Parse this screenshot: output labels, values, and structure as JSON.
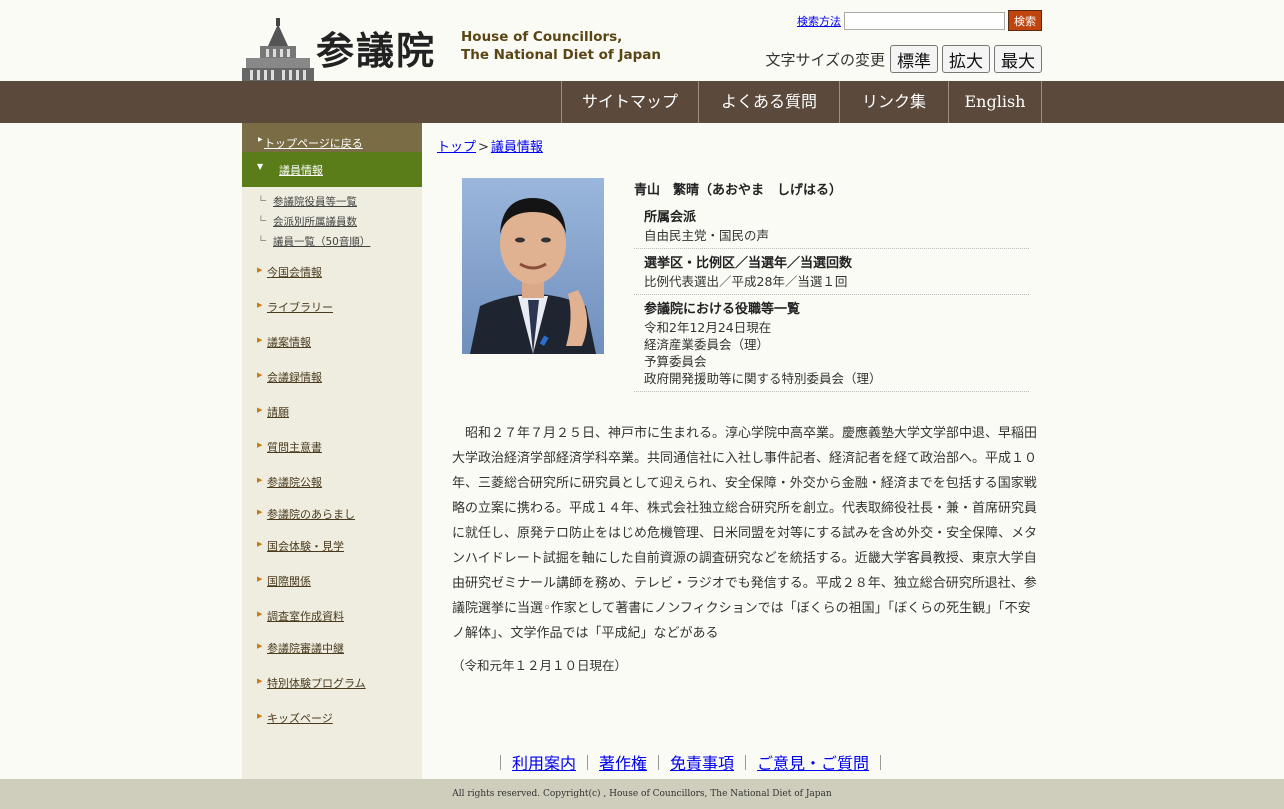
{
  "header": {
    "logo_kanji": "参議院",
    "logo_en_line1": "House of Councillors,",
    "logo_en_line2": "The National Diet of Japan",
    "search_link": "検索方法",
    "search_button": "検索",
    "search_value": "",
    "fontsize_label": "文字サイズの変更",
    "fontsize_buttons": [
      "標準",
      "拡大",
      "最大"
    ]
  },
  "nav": [
    "サイトマップ",
    "よくある質問",
    "リンク集",
    "English"
  ],
  "sidebar": {
    "back": "トップページに戻る",
    "active": "議員情報",
    "subitems": [
      "参議院役員等一覧",
      "会派別所属議員数",
      "議員一覧（50音順）"
    ],
    "items": [
      "今国会情報",
      "ライブラリー",
      "議案情報",
      "会議録情報",
      "請願",
      "質問主意書",
      "参議院公報",
      "参議院のあらまし",
      "国会体験・見学",
      "国際関係",
      "調査室作成資料",
      "参議院審議中継",
      "特別体験プログラム",
      "キッズページ"
    ]
  },
  "breadcrumb": {
    "top": "トップ",
    "sep": ">",
    "current": "議員情報"
  },
  "member": {
    "name": "青山　繁晴（あおやま　しげはる）",
    "party_label": "所属会派",
    "party": "自由民主党・国民の声",
    "district_label": "選挙区・比例区／当選年／当選回数",
    "district": "比例代表選出／平成28年／当選１回",
    "roles_label": "参議院における役職等一覧",
    "roles": [
      "令和2年12月24日現在",
      "経済産業委員会（理）",
      "予算委員会",
      "政府開発援助等に関する特別委員会（理）"
    ],
    "bio": "昭和２７年７月２５日、神戸市に生まれる。淳心学院中高卒業。慶應義塾大学文学部中退、早稲田大学政治経済学部経済学科卒業。共同通信社に入社し事件記者、経済記者を経て政治部へ。平成１０年、三菱総合研究所に研究員として迎えられ、安全保障・外交から金融・経済までを包括する国家戦略の立案に携わる。平成１４年、株式会社独立総合研究所を創立。代表取締役社長・兼・首席研究員に就任し、原発テロ防止をはじめ危機管理、日米同盟を対等にする試みを含め外交・安全保障、メタンハイドレート試掘を軸にした自前資源の調査研究などを統括する。近畿大学客員教授、東京大学自由研究ゼミナール講師を務め、テレビ・ラジオでも発信する。平成２８年、独立総合研究所退社、参議院選挙に当選◦作家として著書にノンフィクションでは「ぼくらの祖国」「ぼくらの死生観」「不安ノ解体」、文学作品では「平成紀」などがある",
    "as_of": "（令和元年１２月１０日現在）"
  },
  "footer": {
    "links": [
      "利用案内",
      "著作権",
      "免責事項",
      "ご意見・ご質問"
    ],
    "copyright": "All rights reserved. Copyright(c) , House of Councillors, The National Diet of Japan"
  },
  "colors": {
    "nav_bg": "#5b4a3c",
    "sidebar_bg": "#efeddf",
    "active_green": "#5a7d1a",
    "back_brown": "#7a6d46",
    "search_btn": "#c0440e"
  }
}
